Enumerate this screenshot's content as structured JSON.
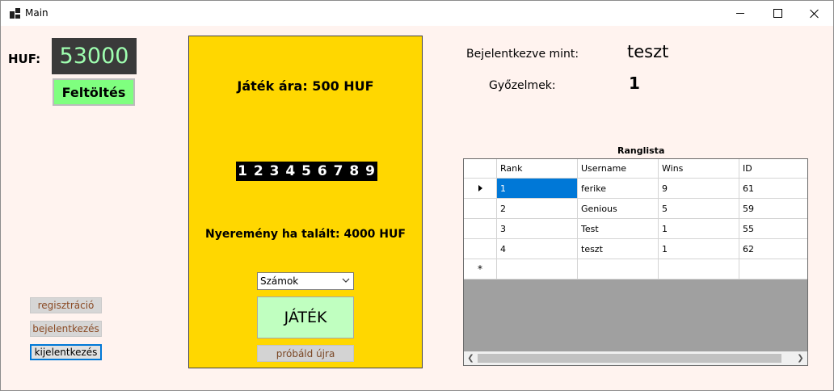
{
  "window": {
    "title": "Main"
  },
  "wallet": {
    "currency_label": "HUF:",
    "balance": "53000",
    "topup_label": "Feltöltés"
  },
  "auth": {
    "register_label": "regisztráció",
    "login_label": "bejelentkezés",
    "logout_label": "kijelentkezés"
  },
  "game": {
    "price_text": "Játék ára: 500 HUF",
    "digits": "1 2 3 4 5 6 7 8 9",
    "prize_text": "Nyeremény ha talált: 4000 HUF",
    "select_value": "Számok",
    "play_label": "JÁTÉK",
    "retry_label": "próbáld újra"
  },
  "profile": {
    "logged_in_label": "Bejelentkezve mint:",
    "username": "teszt",
    "wins_label": "Győzelmek:",
    "wins": "1"
  },
  "leaderboard": {
    "title": "Ranglista",
    "columns": [
      "Rank",
      "Username",
      "Wins",
      "ID"
    ],
    "rows": [
      [
        "1",
        "ferike",
        "9",
        "61"
      ],
      [
        "2",
        "Genious",
        "5",
        "59"
      ],
      [
        "3",
        "Test",
        "1",
        "55"
      ],
      [
        "4",
        "teszt",
        "1",
        "62"
      ]
    ],
    "new_row_marker": "*"
  }
}
